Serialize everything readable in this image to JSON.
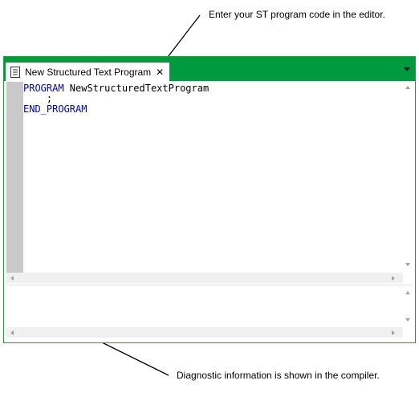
{
  "annotations": {
    "top": "Enter your ST program code in the editor.",
    "bottom": "Diagnostic information is shown in the compiler."
  },
  "tab": {
    "title": "New Structured Text Program",
    "close_glyph": "✕",
    "icon": "document-icon"
  },
  "editor": {
    "lines": [
      {
        "keyword": "PROGRAM",
        "text": " NewStructuredTextProgram"
      },
      {
        "keyword": "",
        "text": "    ;"
      },
      {
        "keyword": "END_PROGRAM",
        "text": ""
      }
    ]
  },
  "colors": {
    "accent": "#009a3e",
    "keyword": "#0000cc",
    "gutter": "#c9c9c9"
  }
}
